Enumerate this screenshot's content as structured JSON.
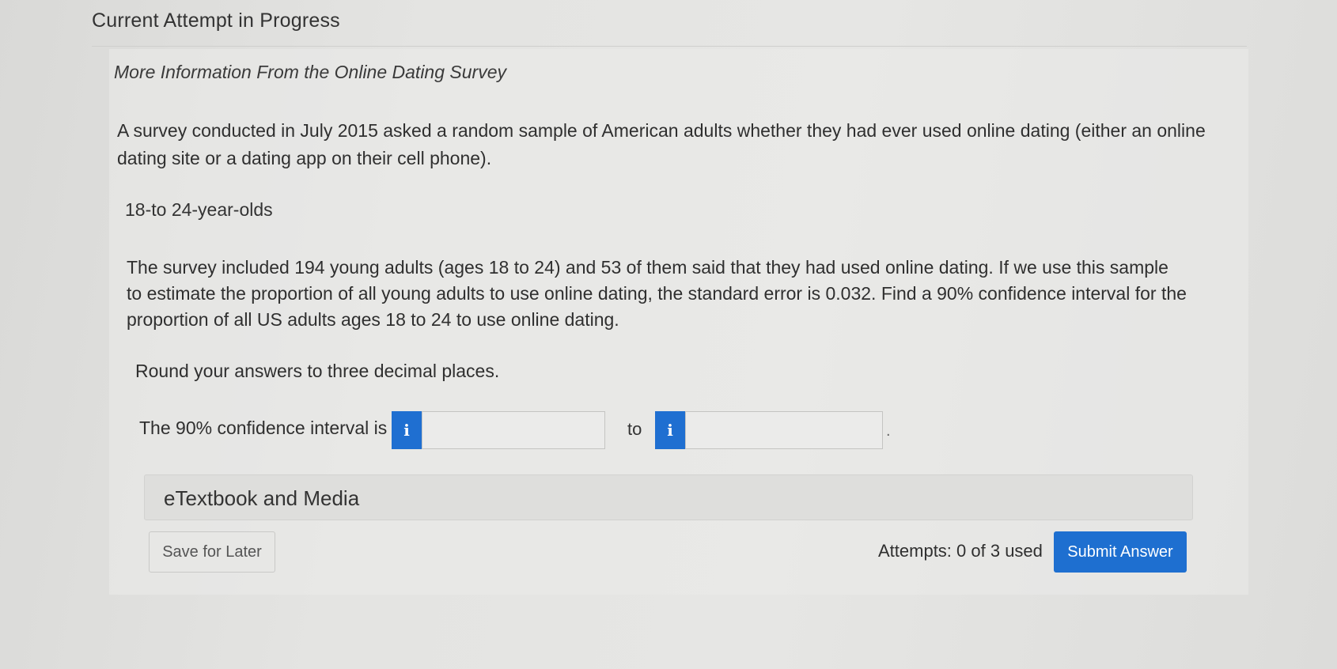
{
  "header": {
    "title": "Current Attempt in Progress"
  },
  "question": {
    "heading": "More Information From the Online Dating Survey",
    "intro": "A survey conducted in July 2015 asked a random sample of American adults whether they had ever used online dating (either an online dating site or a dating app on their cell phone).",
    "subheading": "18-to 24-year-olds",
    "problem": "The survey included 194 young adults (ages 18 to 24) and 53 of them said that they had used online dating. If we use this sample to estimate the proportion of all young adults to use online dating, the standard error is 0.032. Find a 90% confidence interval for the proportion of all US adults ages 18 to 24 to use online dating.",
    "round_note": "Round your answers to three decimal places."
  },
  "answer": {
    "label": "The 90% confidence interval is",
    "info_icon_glyph": "i",
    "lower_value": "",
    "connector": "to",
    "upper_value": "",
    "period": "."
  },
  "media": {
    "label": "eTextbook and Media"
  },
  "footer": {
    "save_label": "Save for Later",
    "attempts_text": "Attempts: 0 of 3 used",
    "submit_label": "Submit Answer"
  },
  "colors": {
    "accent": "#1e6fd0",
    "background": "#e4e4e2"
  }
}
